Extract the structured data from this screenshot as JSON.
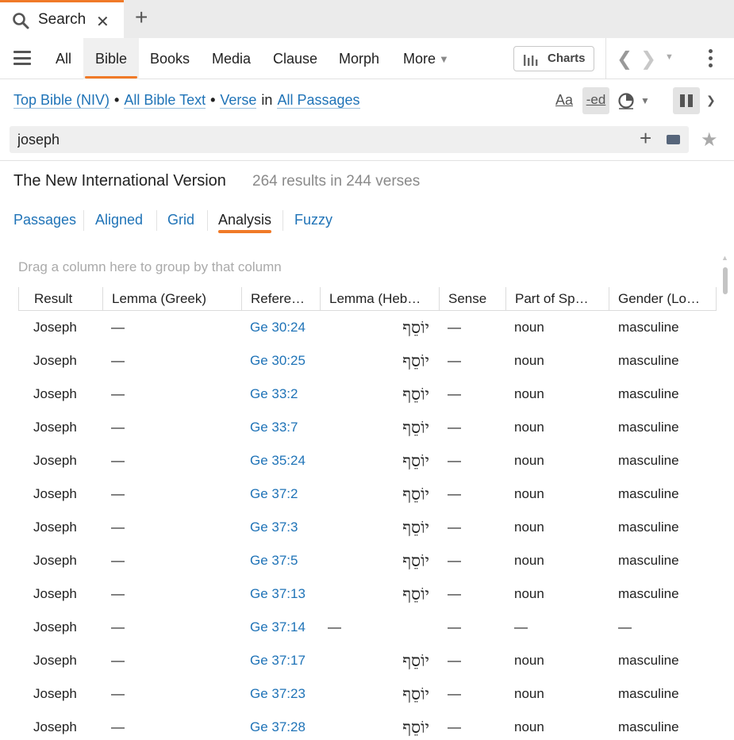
{
  "tab": {
    "label": "Search"
  },
  "nav": {
    "items": [
      {
        "label": "All",
        "active": false
      },
      {
        "label": "Bible",
        "active": true
      },
      {
        "label": "Books",
        "active": false
      },
      {
        "label": "Media",
        "active": false
      },
      {
        "label": "Clause",
        "active": false
      },
      {
        "label": "Morph",
        "active": false
      }
    ],
    "more_label": "More",
    "charts_label": "Charts"
  },
  "scope": {
    "bible": "Top Bible (NIV)",
    "text": "All Bible Text",
    "unit": "Verse",
    "in": "in",
    "range": "All Passages"
  },
  "toolbar": {
    "font_label": "Aa",
    "edit_label": "-ed"
  },
  "search": {
    "query": "joseph"
  },
  "results": {
    "resource": "The New International Version",
    "count": "264 results in 244 verses"
  },
  "subtabs": [
    "Passages",
    "Aligned",
    "Grid",
    "Analysis",
    "Fuzzy"
  ],
  "active_subtab": "Analysis",
  "group_hint": "Drag a column here to group by that column",
  "columns": [
    "Result",
    "Lemma (Greek)",
    "Reference",
    "Lemma (Hebrew)",
    "Sense",
    "Part of Speech",
    "Gender (Louw-Nida)"
  ],
  "column_headers_shown": [
    "Result",
    "Lemma (Greek)",
    "Refere…",
    "Lemma (Heb…",
    "Sense",
    "Part of Sp…",
    "Gender (Lo…"
  ],
  "rows": [
    {
      "result": "Joseph",
      "greek": "—",
      "ref": "Ge 30:24",
      "hebrew": "יוֹסֵף",
      "sense": "—",
      "pos": "noun",
      "gender": "masculine"
    },
    {
      "result": "Joseph",
      "greek": "—",
      "ref": "Ge 30:25",
      "hebrew": "יוֹסֵף",
      "sense": "—",
      "pos": "noun",
      "gender": "masculine"
    },
    {
      "result": "Joseph",
      "greek": "—",
      "ref": "Ge 33:2",
      "hebrew": "יוֹסֵף",
      "sense": "—",
      "pos": "noun",
      "gender": "masculine"
    },
    {
      "result": "Joseph",
      "greek": "—",
      "ref": "Ge 33:7",
      "hebrew": "יוֹסֵף",
      "sense": "—",
      "pos": "noun",
      "gender": "masculine"
    },
    {
      "result": "Joseph",
      "greek": "—",
      "ref": "Ge 35:24",
      "hebrew": "יוֹסֵף",
      "sense": "—",
      "pos": "noun",
      "gender": "masculine"
    },
    {
      "result": "Joseph",
      "greek": "—",
      "ref": "Ge 37:2",
      "hebrew": "יוֹסֵף",
      "sense": "—",
      "pos": "noun",
      "gender": "masculine"
    },
    {
      "result": "Joseph",
      "greek": "—",
      "ref": "Ge 37:3",
      "hebrew": "יוֹסֵף",
      "sense": "—",
      "pos": "noun",
      "gender": "masculine"
    },
    {
      "result": "Joseph",
      "greek": "—",
      "ref": "Ge 37:5",
      "hebrew": "יוֹסֵף",
      "sense": "—",
      "pos": "noun",
      "gender": "masculine"
    },
    {
      "result": "Joseph",
      "greek": "—",
      "ref": "Ge 37:13",
      "hebrew": "יוֹסֵף",
      "sense": "—",
      "pos": "noun",
      "gender": "masculine"
    },
    {
      "result": "Joseph",
      "greek": "—",
      "ref": "Ge 37:14",
      "hebrew": "—",
      "sense": "—",
      "pos": "—",
      "gender": "—"
    },
    {
      "result": "Joseph",
      "greek": "—",
      "ref": "Ge 37:17",
      "hebrew": "יוֹסֵף",
      "sense": "—",
      "pos": "noun",
      "gender": "masculine"
    },
    {
      "result": "Joseph",
      "greek": "—",
      "ref": "Ge 37:23",
      "hebrew": "יוֹסֵף",
      "sense": "—",
      "pos": "noun",
      "gender": "masculine"
    },
    {
      "result": "Joseph",
      "greek": "—",
      "ref": "Ge 37:28",
      "hebrew": "יוֹסֵף",
      "sense": "—",
      "pos": "noun",
      "gender": "masculine"
    }
  ],
  "colors": {
    "accent": "#f07a28",
    "link": "#1f73b7",
    "muted": "#8a8a8a"
  }
}
